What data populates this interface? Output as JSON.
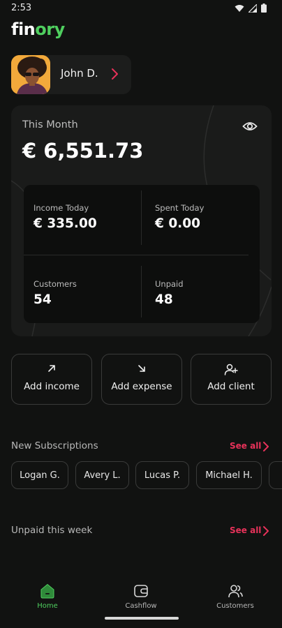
{
  "status_bar": {
    "time": "2:53"
  },
  "brand": {
    "logo_part1": "fin",
    "logo_part2": "ory",
    "accent": "#4fcf5f"
  },
  "profile": {
    "name": "John D."
  },
  "summary": {
    "period_label": "This Month",
    "total": "€ 6,551.73",
    "stats": [
      {
        "label": "Income Today",
        "value": "€ 335.00"
      },
      {
        "label": "Spent Today",
        "value": "€ 0.00"
      },
      {
        "label": "Customers",
        "value": "54"
      },
      {
        "label": "Unpaid",
        "value": "48"
      }
    ]
  },
  "actions": [
    {
      "label": "Add income",
      "icon": "arrow-up-right-icon"
    },
    {
      "label": "Add expense",
      "icon": "arrow-down-right-icon"
    },
    {
      "label": "Add client",
      "icon": "add-user-icon"
    }
  ],
  "subscriptions": {
    "title": "New Subscriptions",
    "see_all": "See all",
    "items": [
      "Logan G.",
      "Avery L.",
      "Lucas P.",
      "Michael H."
    ]
  },
  "unpaid": {
    "title": "Unpaid this week",
    "see_all": "See all"
  },
  "nav": {
    "items": [
      {
        "label": "Home",
        "icon": "home-icon",
        "active": true
      },
      {
        "label": "Cashflow",
        "icon": "wallet-icon",
        "active": false
      },
      {
        "label": "Customers",
        "icon": "users-icon",
        "active": false
      }
    ]
  },
  "colors": {
    "accent_red": "#e8325a",
    "background": "#111211",
    "card": "#1a1b1a"
  }
}
